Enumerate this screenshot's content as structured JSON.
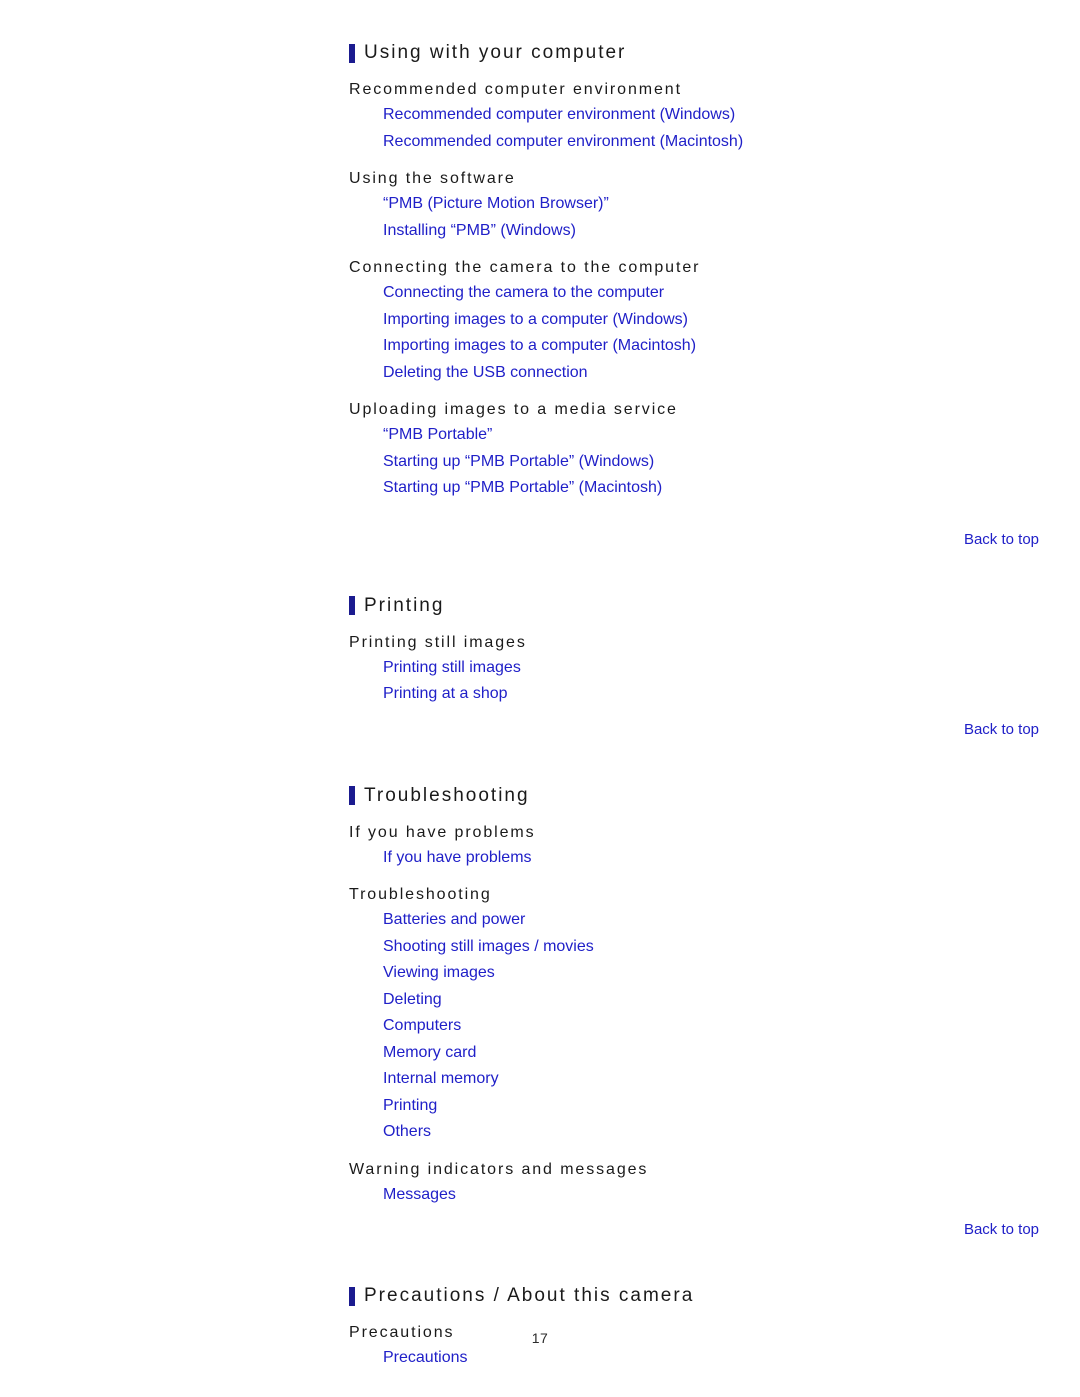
{
  "page": {
    "number": "17",
    "accent_bar_color": "#1b1b8f",
    "link_color": "#2020c8",
    "heading_color": "#1a1a1a",
    "background_color": "#ffffff"
  },
  "back_to_top_label": "Back to top",
  "sections": [
    {
      "title": "Using with your computer",
      "groups": [
        {
          "heading": "Recommended computer environment",
          "links": [
            "Recommended computer environment (Windows)",
            "Recommended computer environment (Macintosh)"
          ]
        },
        {
          "heading": "Using the software",
          "links": [
            "“PMB (Picture Motion Browser)”",
            "Installing “PMB” (Windows)"
          ]
        },
        {
          "heading": "Connecting the camera to the computer",
          "links": [
            "Connecting the camera to the computer",
            "Importing images to a computer (Windows)",
            "Importing images to a computer (Macintosh)",
            "Deleting the USB connection"
          ]
        },
        {
          "heading": "Uploading images to a media service",
          "links": [
            "“PMB Portable”",
            "Starting up “PMB Portable” (Windows)",
            "Starting up “PMB Portable” (Macintosh)"
          ]
        }
      ]
    },
    {
      "title": "Printing",
      "groups": [
        {
          "heading": "Printing still images",
          "links": [
            "Printing still images",
            "Printing at a shop"
          ]
        }
      ]
    },
    {
      "title": "Troubleshooting",
      "groups": [
        {
          "heading": "If you have problems",
          "links": [
            "If you have problems"
          ]
        },
        {
          "heading": "Troubleshooting",
          "links": [
            "Batteries and power",
            "Shooting still images / movies",
            "Viewing images",
            "Deleting",
            "Computers",
            "Memory card",
            "Internal memory",
            "Printing",
            "Others"
          ]
        },
        {
          "heading": "Warning indicators and messages",
          "links": [
            "Messages"
          ]
        }
      ]
    },
    {
      "title": "Precautions / About this camera",
      "groups": [
        {
          "heading": "Precautions",
          "links": [
            "Precautions"
          ]
        }
      ]
    }
  ]
}
